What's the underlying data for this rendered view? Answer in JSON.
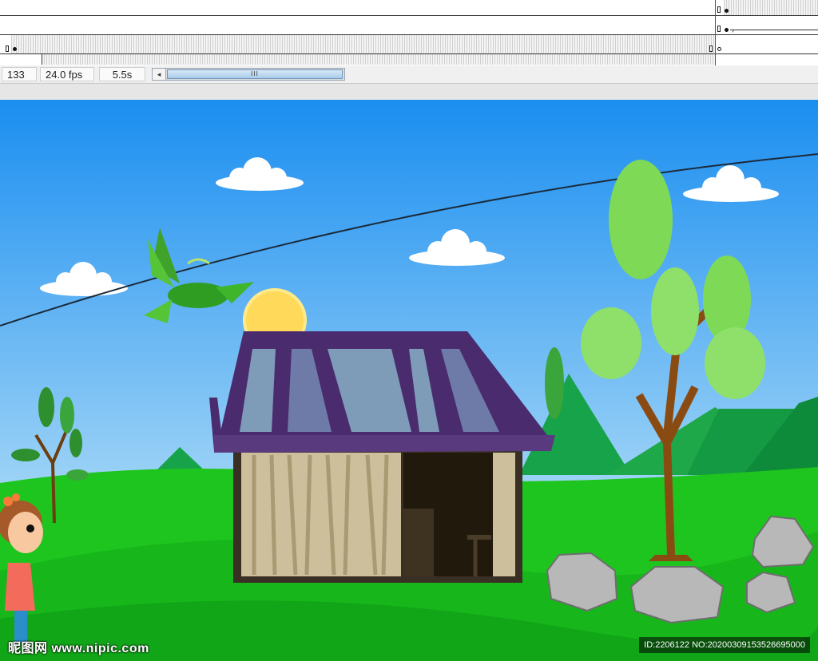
{
  "statusbar": {
    "frame": "133",
    "fps": "24.0 fps",
    "time": "5.5s"
  },
  "scrollbar": {
    "left_arrow": "◂",
    "thumb_grip": "III"
  },
  "watermark": {
    "site": "昵图网 www.nipic.com",
    "id": "ID:2206122 NO:20200309153526695000"
  },
  "colors": {
    "sky_top": "#1a8ef0",
    "sky_bottom": "#a9d9f7",
    "grass": "#1ec51e",
    "roof": "#4a2b6e",
    "sun": "#ffd95a",
    "tree_leaf": "#7ed957",
    "trunk": "#8a4b12"
  },
  "icons": [
    "keyframe-icon",
    "dot-icon",
    "ring-icon",
    "scroll-left-arrow-icon"
  ]
}
